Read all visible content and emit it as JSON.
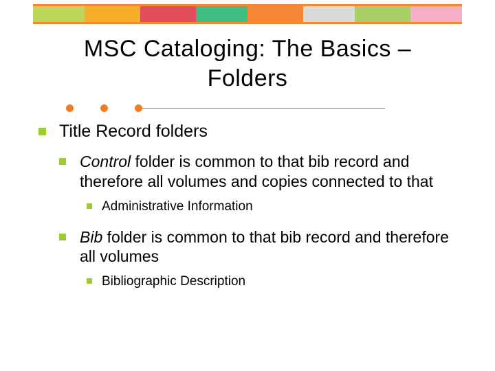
{
  "title": "MSC Cataloging: The Basics – Folders",
  "body": {
    "lvl1": "Title Record folders",
    "items": [
      {
        "lead": "Control",
        "rest": "  folder is common to that bib record and therefore all volumes and copies connected to that",
        "sub": "Administrative Information"
      },
      {
        "lead": "Bib",
        "rest": " folder is common to that bib record and therefore all volumes",
        "sub": "Bibliographic Description"
      }
    ]
  }
}
